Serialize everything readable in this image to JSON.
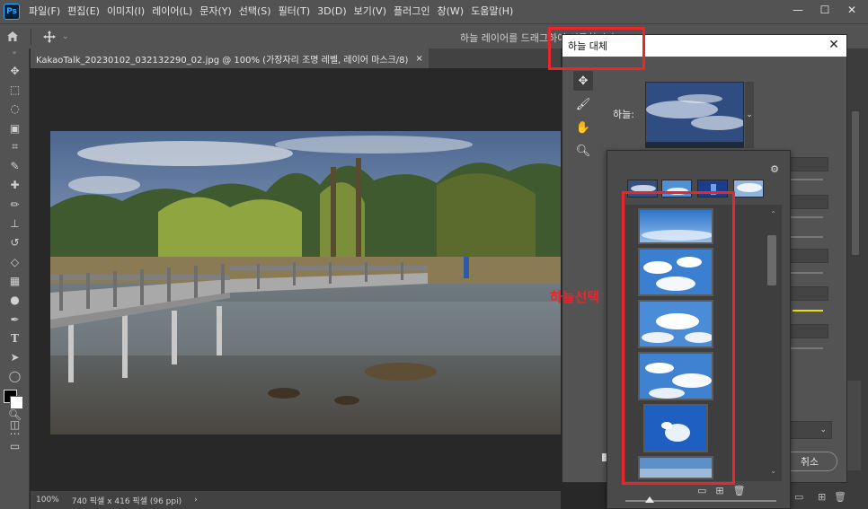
{
  "app": {
    "logo": "Ps"
  },
  "menu": {
    "items": [
      "파일(F)",
      "편집(E)",
      "이미지(I)",
      "레이어(L)",
      "문자(Y)",
      "선택(S)",
      "필터(T)",
      "3D(D)",
      "보기(V)",
      "플러그인",
      "창(W)",
      "도움말(H)"
    ]
  },
  "window_controls": {
    "minimize": "—",
    "restore": "☐",
    "close": "✕"
  },
  "options_bar": {
    "hint": "하늘 레이어를 드래그하여 이동합니다"
  },
  "document": {
    "tab_title": "KakaoTalk_20230102_032132290_02.jpg @ 100% (가장자리 조명 레벨, 레이어 마스크/8)",
    "tab_close": "×"
  },
  "status": {
    "zoom": "100%",
    "dimensions": "740 픽셀 x 416 픽셀 (96 ppi)",
    "arrow": "›"
  },
  "dialog": {
    "title": "하늘 대체",
    "close": "✕",
    "sky_label": "하늘:",
    "cancel_label": "취소"
  },
  "annotation": {
    "text": "하늘선택",
    "color": "#e8262b"
  },
  "icons": {
    "home": "home-icon",
    "move": "move-icon",
    "gear": "gear-icon",
    "brush": "brush-icon",
    "hand": "hand-icon",
    "zoom": "zoom-icon"
  },
  "colors": {
    "highlight": "#e8262b",
    "panel": "#535353",
    "canvas": "#282828",
    "accent_yellow": "#e8e000"
  }
}
